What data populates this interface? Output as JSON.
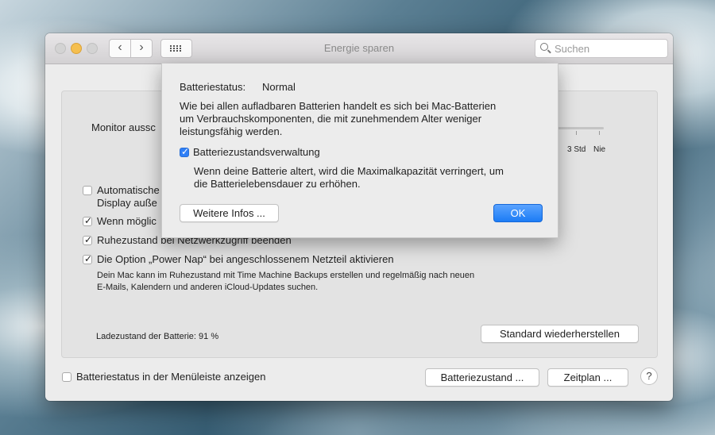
{
  "window": {
    "title": "Energie sparen",
    "search_placeholder": "Suchen",
    "nav_back": "‹",
    "nav_fwd": "›"
  },
  "main": {
    "monitor_label": "Monitor aussc",
    "slider_label_3h": "3 Std",
    "slider_label_never": "Nie",
    "options": [
      {
        "label_line1": "Automatische",
        "label_line2": "Display auße",
        "checked": false
      },
      {
        "label": "Wenn möglic",
        "checked": true
      },
      {
        "label": "Ruhezustand bei Netzwerkzugriff beenden",
        "checked": true
      },
      {
        "label": "Die Option „Power Nap“ bei angeschlossenem Netzteil aktivieren",
        "checked": true
      }
    ],
    "power_nap_description_line1": "Dein Mac kann im Ruhezustand mit Time Machine Backups erstellen und regelmäßig nach neuen",
    "power_nap_description_line2": "E-Mails, Kalendern und anderen iCloud-Updates suchen.",
    "battery_charge_text": "Ladezustand der Batterie: 91 %",
    "restore_defaults_label": "Standard wiederherstellen"
  },
  "footer": {
    "menubar_checkbox_label": "Batteriestatus in der Menüleiste anzeigen",
    "menubar_checked": false,
    "battery_health_button": "Batteriezustand ...",
    "schedule_button": "Zeitplan ...",
    "help_label": "?"
  },
  "sheet": {
    "status_label": "Batteriestatus:",
    "status_value": "Normal",
    "description_line1": "Wie bei allen aufladbaren Batterien handelt es sich bei Mac-Batterien",
    "description_line2": "um Verbrauchskomponenten, die mit zunehmendem Alter weniger",
    "description_line3": "leistungsfähig werden.",
    "management_label": "Batteriezustandsverwaltung",
    "management_checked": true,
    "management_detail_line1": "Wenn deine Batterie altert, wird die Maximalkapazität verringert, um",
    "management_detail_line2": "die Batterielebensdauer zu erhöhen.",
    "more_info_button": "Weitere Infos ...",
    "ok_button": "OK"
  },
  "colors": {
    "accent": "#1c7cf5",
    "minimize": "#f5bf4f"
  }
}
